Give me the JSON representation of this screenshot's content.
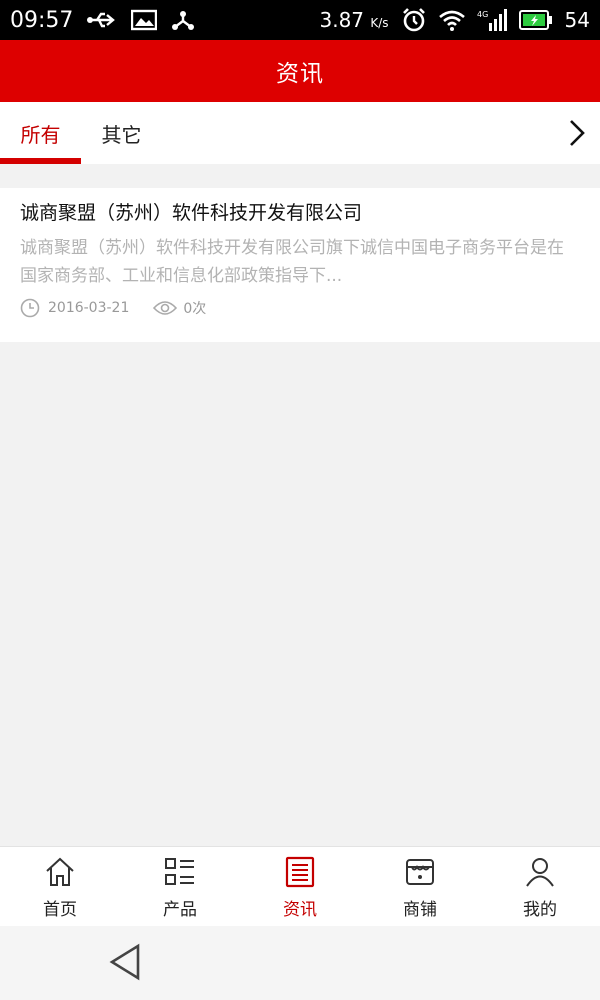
{
  "statusbar": {
    "time": "09:57",
    "speed": "3.87",
    "speed_unit": "K/s",
    "network": "4G",
    "battery": "54"
  },
  "appbar": {
    "title": "资讯"
  },
  "tabs": {
    "items": [
      {
        "label": "所有",
        "active": true
      },
      {
        "label": "其它",
        "active": false
      }
    ]
  },
  "news": [
    {
      "title": "诚商聚盟（苏州）软件科技开发有限公司",
      "summary": "诚商聚盟（苏州）软件科技开发有限公司旗下诚信中国电子商务平台是在国家商务部、工业和信息化部政策指导下...",
      "date": "2016-03-21",
      "views": "0次"
    }
  ],
  "bottomnav": {
    "items": [
      {
        "label": "首页"
      },
      {
        "label": "产品"
      },
      {
        "label": "资讯"
      },
      {
        "label": "商铺"
      },
      {
        "label": "我的"
      }
    ]
  },
  "colors": {
    "brand_red": "#dd0000",
    "active_red": "#c40000"
  }
}
